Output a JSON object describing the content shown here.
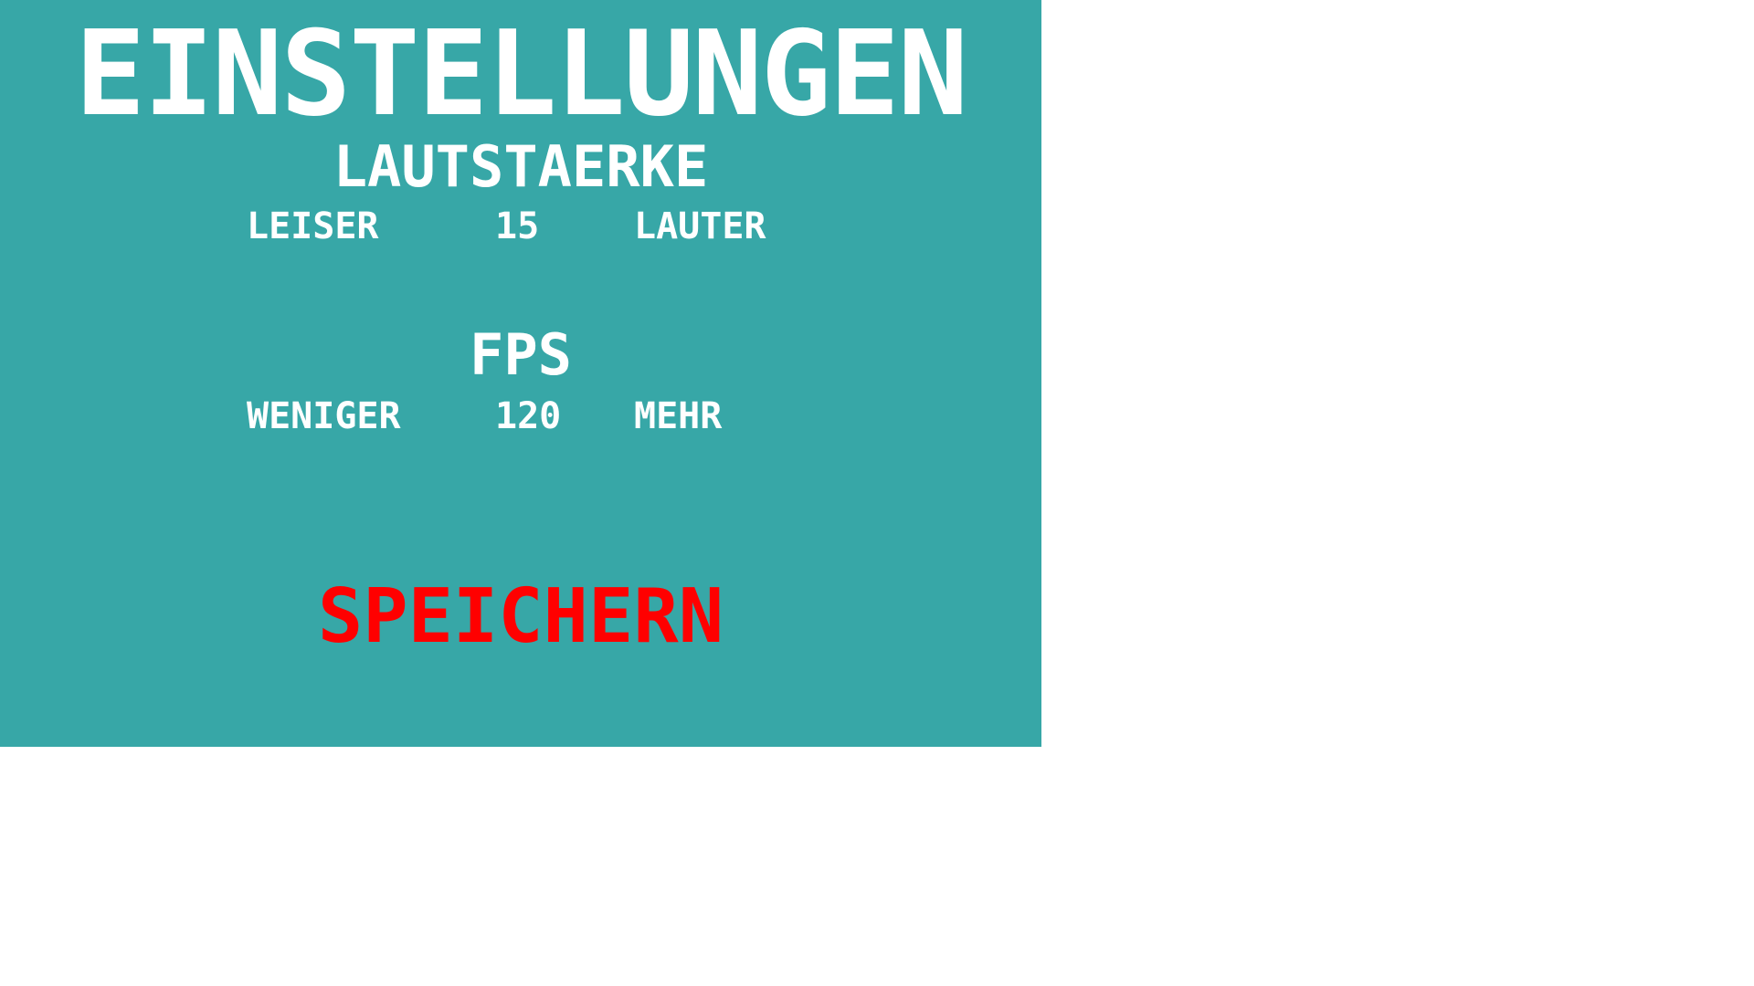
{
  "settings": {
    "title": "EINSTELLUNGEN",
    "volume": {
      "heading": "LAUTSTAERKE",
      "decrease_label": "LEISER",
      "value": "15",
      "increase_label": "LAUTER"
    },
    "fps": {
      "heading": "FPS",
      "decrease_label": "WENIGER",
      "value": "120",
      "increase_label": "MEHR"
    },
    "save_label": "SPEICHERN"
  },
  "colors": {
    "background": "#37a7a7",
    "text": "#ffffff",
    "save": "#ff0000"
  }
}
